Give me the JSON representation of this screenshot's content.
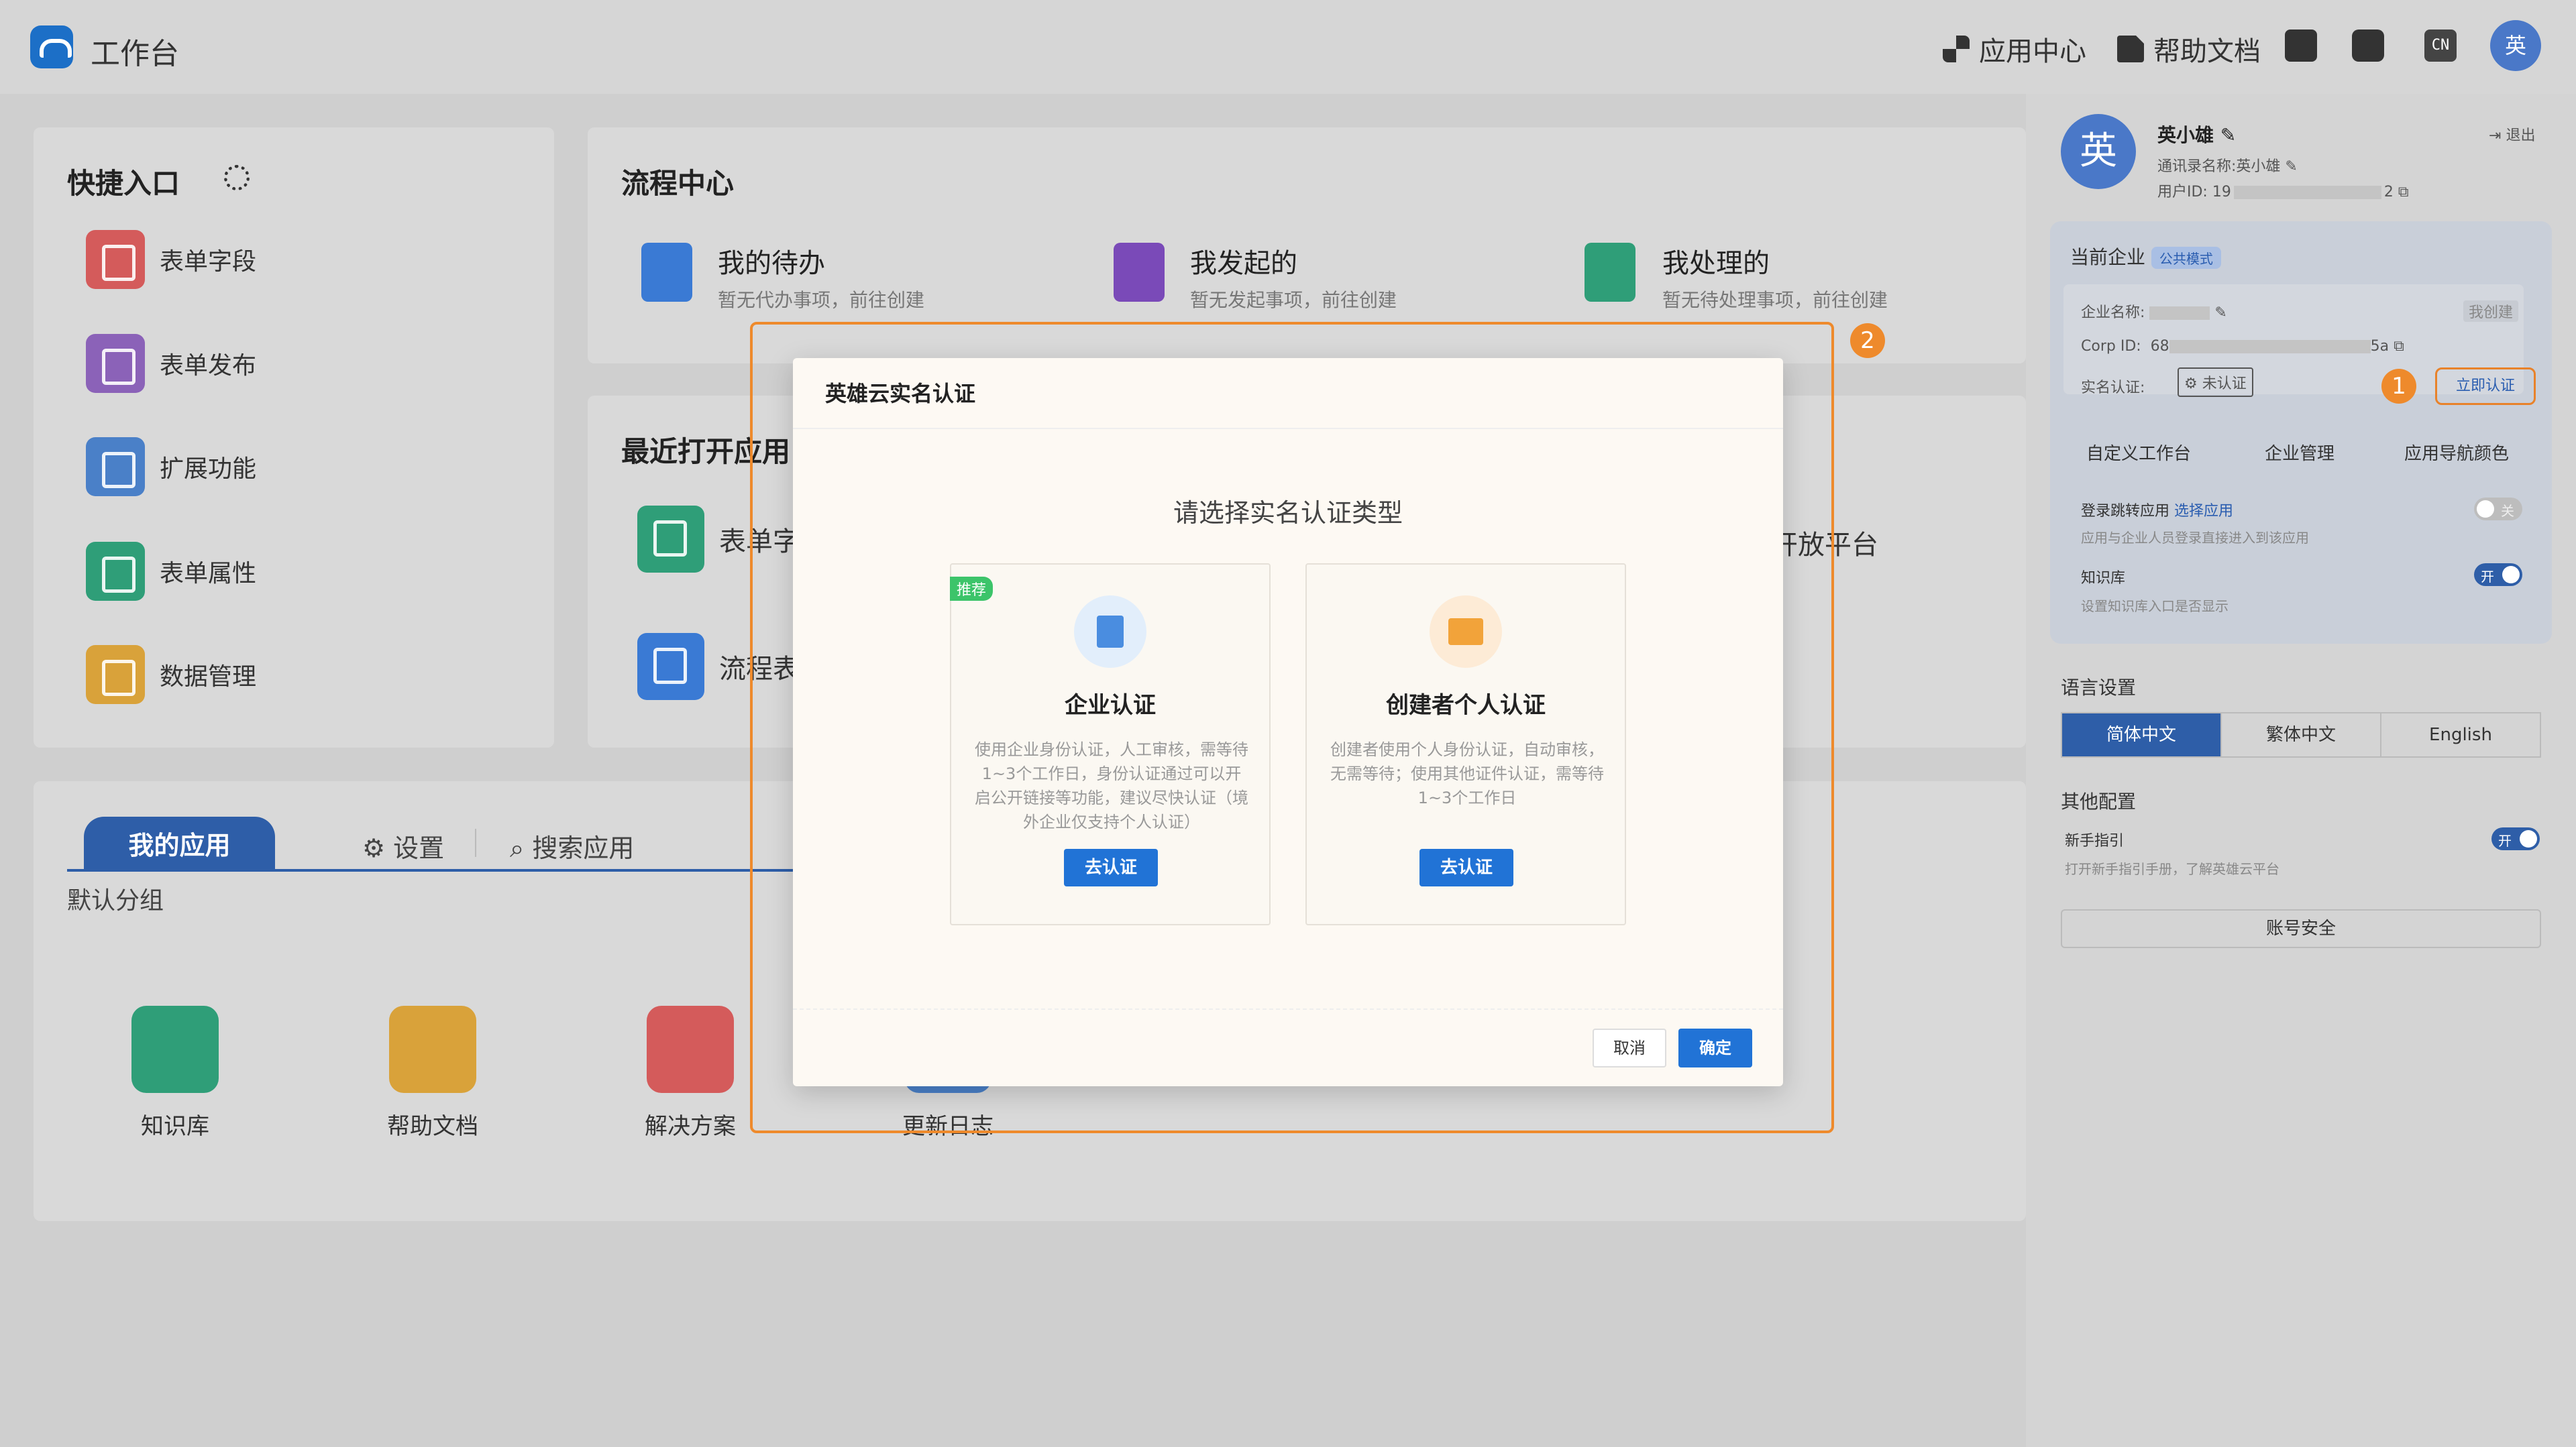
{
  "header": {
    "app_title": "工作台",
    "app_center": "应用中心",
    "help_docs": "帮助文档",
    "lang_code": "CN",
    "avatar_char": "英"
  },
  "quick": {
    "title": "快捷入口",
    "items": [
      "表单字段",
      "表单发布",
      "扩展功能",
      "表单属性",
      "数据管理"
    ]
  },
  "process": {
    "title": "流程中心",
    "items": [
      {
        "title": "我的待办",
        "sub": "暂无代办事项，前往创建"
      },
      {
        "title": "我发起的",
        "sub": "暂无发起事项，前往创建"
      },
      {
        "title": "我处理的",
        "sub": "暂无待处理事项，前往创建"
      }
    ]
  },
  "recent": {
    "title": "最近打开应用",
    "items": [
      "表单字",
      "流程表"
    ],
    "right_partial": "开放平台"
  },
  "myapps": {
    "tab_active": "我的应用",
    "tab_settings": "设置",
    "tab_search": "搜索应用",
    "group": "默认分组",
    "apps": [
      "知识库",
      "帮助文档",
      "解决方案",
      "更新日志"
    ]
  },
  "right": {
    "user_name": "英小雄",
    "logout": "退出",
    "contact_name": "通讯录名称:英小雄",
    "user_id": "用户ID: 19",
    "user_id_tail": "2",
    "current_company": "当前企业",
    "public_mode": "公共模式",
    "company_name_label": "企业名称:",
    "my_created": "我创建",
    "corp_id_label": "Corp ID:",
    "corp_id_head": "68",
    "corp_id_tail": "5a",
    "verify_label": "实名认证:",
    "unverified": "未认证",
    "verify_now": "立即认证",
    "tabs": [
      "自定义工作台",
      "企业管理",
      "应用导航颜色"
    ],
    "login_jump": "登录跳转应用",
    "select_app": "选择应用",
    "login_jump_desc": "应用与企业人员登录直接进入到该应用",
    "toggle_off": "关",
    "toggle_on": "开",
    "kb": "知识库",
    "kb_desc": "设置知识库入口是否显示",
    "lang_title": "语言设置",
    "langs": [
      "简体中文",
      "繁体中文",
      "English"
    ],
    "other_title": "其他配置",
    "guide": "新手指引",
    "guide_desc": "打开新手指引手册，了解英雄云平台",
    "account_security": "账号安全",
    "badge1": "1",
    "badge2": "2"
  },
  "modal": {
    "title": "英雄云实名认证",
    "subtitle": "请选择实名认证类型",
    "recommend": "推荐",
    "options": [
      {
        "name": "企业认证",
        "desc": "使用企业身份认证，人工审核，需等待1~3个工作日，身份认证通过可以开启公开链接等功能，建议尽快认证（境外企业仅支持个人认证）",
        "btn": "去认证"
      },
      {
        "name": "创建者个人认证",
        "desc": "创建者使用个人身份认证，自动审核，无需等待；使用其他证件认证，需等待1~3个工作日",
        "btn": "去认证"
      }
    ],
    "cancel": "取消",
    "ok": "确定"
  },
  "colors": {
    "primary": "#2173d6",
    "accent_orange": "#ee8a2c",
    "recommend_green": "#3cc46a"
  }
}
